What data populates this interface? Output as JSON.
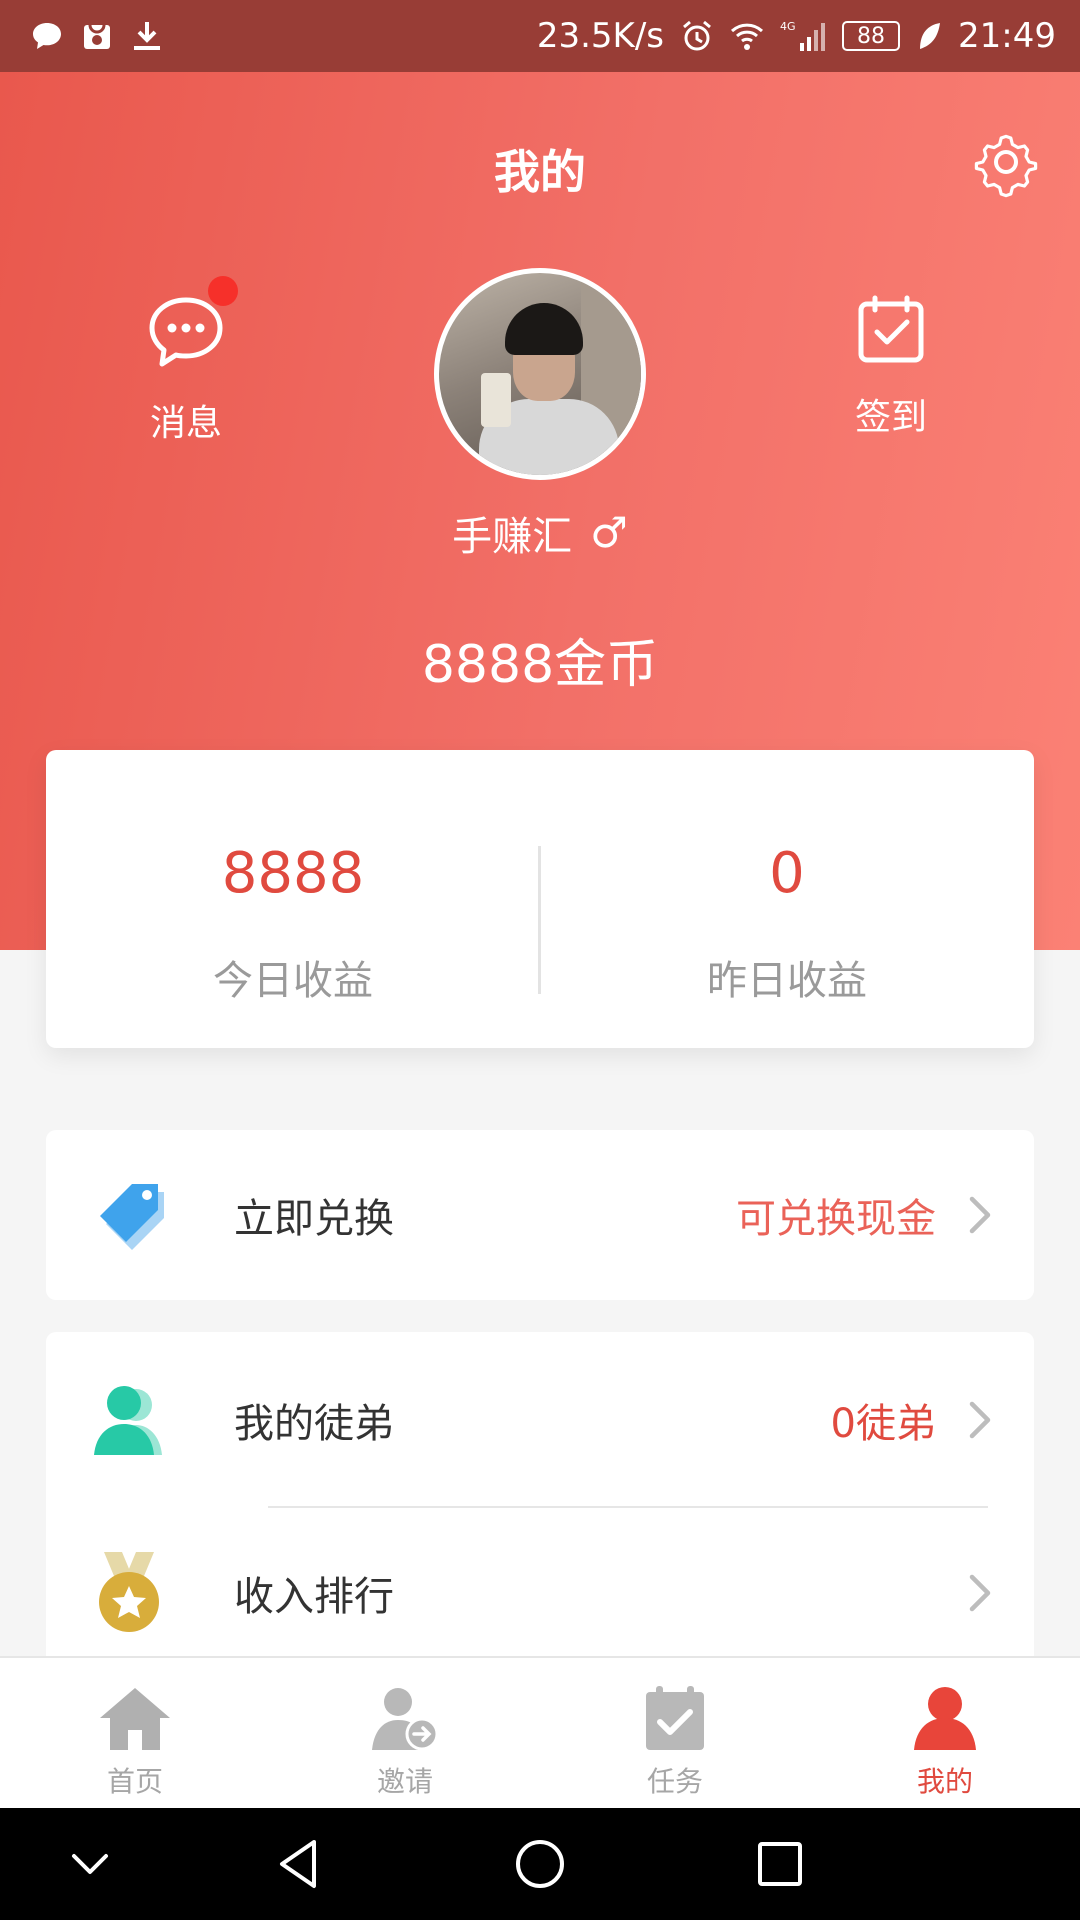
{
  "status_bar": {
    "net_speed": "23.5K/s",
    "network_type": "4G",
    "battery": "88",
    "time": "21:49",
    "left_icons": [
      "chat-bubble-icon",
      "huawei-store-icon",
      "download-icon"
    ],
    "right_icons": [
      "alarm-icon",
      "wifi-icon",
      "signal-icon",
      "battery-icon",
      "leaf-icon"
    ]
  },
  "header": {
    "title": "我的",
    "messages_label": "消息",
    "signin_label": "签到",
    "username": "手赚汇",
    "gender_symbol": "♂",
    "coins": "8888金币"
  },
  "earnings": {
    "today": {
      "value": "8888",
      "label": "今日收益"
    },
    "yesterday": {
      "value": "0",
      "label": "昨日收益"
    }
  },
  "menu": {
    "exchange": {
      "label": "立即兑换",
      "hint": "可兑换现金"
    },
    "apprentices": {
      "label": "我的徒弟",
      "hint": "0徒弟"
    },
    "ranking": {
      "label": "收入排行"
    }
  },
  "tabs": [
    {
      "label": "首页",
      "icon": "home-icon"
    },
    {
      "label": "邀请",
      "icon": "invite-icon"
    },
    {
      "label": "任务",
      "icon": "task-icon"
    },
    {
      "label": "我的",
      "icon": "profile-icon",
      "active": true
    }
  ],
  "colors": {
    "header_gradient_start": "#e9584d",
    "header_gradient_end": "#fb8175",
    "accent_red": "#e04a3f",
    "hint_red": "#ea6258",
    "tag_blue": "#3fa3ec",
    "teal": "#27c9a6",
    "medal_gold": "#d8ad3b",
    "tab_inactive": "#a6a6a6"
  }
}
